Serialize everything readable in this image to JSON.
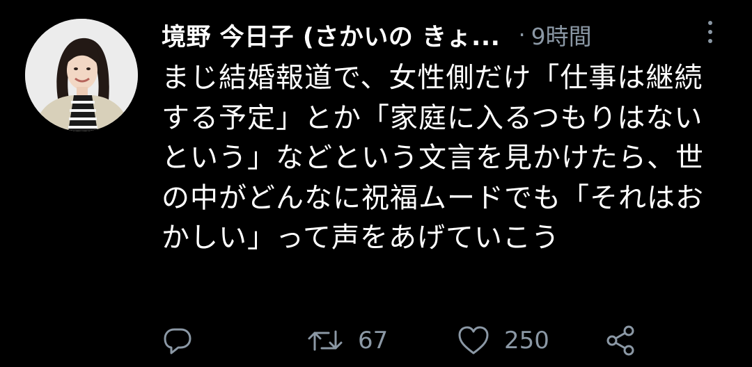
{
  "tweet": {
    "display_name": "境野 今日子 (さかいの きょ...",
    "separator": "·",
    "timestamp": "9時間",
    "body": "まじ結婚報道で、女性側だけ「仕事は継続する予定」とか「家庭に入るつもりはないという」などという文言を見かけたら、世の中がどんなに祝福ムードでも「それはおかしい」って声をあげていこう",
    "actions": {
      "reply_icon": "reply-icon",
      "retweet_icon": "retweet-icon",
      "retweet_count": "67",
      "like_icon": "heart-icon",
      "like_count": "250",
      "share_icon": "share-icon"
    }
  },
  "colors": {
    "background": "#000000",
    "text": "#ffffff",
    "secondary": "#8b98a5"
  }
}
